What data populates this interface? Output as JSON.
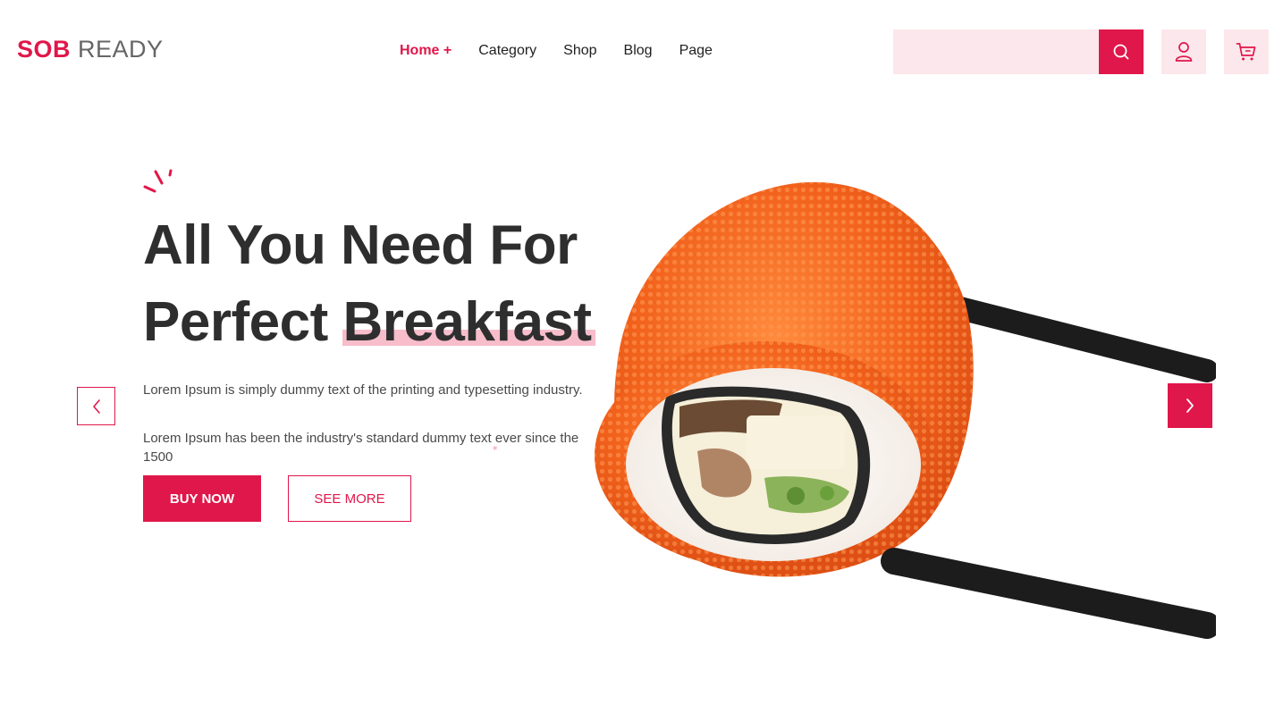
{
  "header": {
    "logo_brand": "SOB",
    "logo_rest": "READY",
    "nav": [
      {
        "label": "Home +",
        "active": true
      },
      {
        "label": "Category",
        "active": false
      },
      {
        "label": "Shop",
        "active": false
      },
      {
        "label": "Blog",
        "active": false
      },
      {
        "label": "Page",
        "active": false
      }
    ],
    "search_value": "",
    "icons": [
      "search-icon",
      "user-icon",
      "cart-icon"
    ]
  },
  "hero": {
    "title_line1": "All You Need For",
    "title_line2_plain": "Perfect",
    "title_line2_highlight": "Breakfast",
    "desc1": "Lorem Ipsum is simply dummy text of the printing and typesetting industry.",
    "desc2": "Lorem Ipsum has been the industry's standard dummy text ever since the 1500",
    "buy_label": "BUY NOW",
    "more_label": "SEE MORE",
    "image": "sushi-roll-with-chopsticks"
  },
  "colors": {
    "accent": "#e0174a",
    "accent_light": "#fce7ec",
    "highlight": "#f4a7ba",
    "text_dark": "#2e2e2e"
  }
}
